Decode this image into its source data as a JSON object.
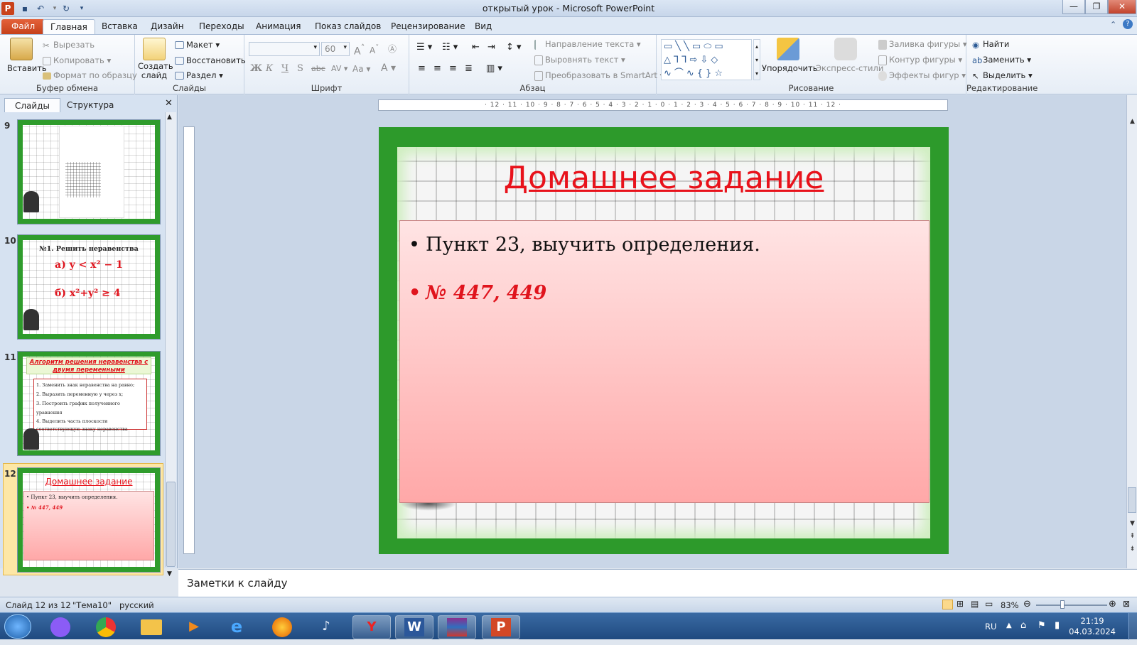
{
  "window": {
    "title": "открытый урок  -  Microsoft PowerPoint"
  },
  "ribbon_tabs": [
    "Файл",
    "Главная",
    "Вставка",
    "Дизайн",
    "Переходы",
    "Анимация",
    "Показ слайдов",
    "Рецензирование",
    "Вид"
  ],
  "clipboard": {
    "paste": "Вставить",
    "cut": "Вырезать",
    "copy": "Копировать",
    "format_painter": "Формат по образцу",
    "label": "Буфер обмена"
  },
  "slides_group": {
    "new_slide": "Создать слайд",
    "layout": "Макет",
    "reset": "Восстановить",
    "section": "Раздел",
    "label": "Слайды"
  },
  "font_group": {
    "font_size": "60",
    "label": "Шрифт"
  },
  "paragraph_group": {
    "text_direction": "Направление текста",
    "align_text": "Выровнять текст",
    "smartart": "Преобразовать в SmartArt",
    "label": "Абзац"
  },
  "drawing_group": {
    "arrange": "Упорядочить",
    "quick_styles": "Экспресс-стили",
    "shape_fill": "Заливка фигуры",
    "shape_outline": "Контур фигуры",
    "shape_effects": "Эффекты фигур",
    "label": "Рисование"
  },
  "editing_group": {
    "find": "Найти",
    "replace": "Заменить",
    "select": "Выделить",
    "label": "Редактирование"
  },
  "left_pane": {
    "tab_slides": "Слайды",
    "tab_outline": "Структура"
  },
  "thumbnails": [
    {
      "num": "9"
    },
    {
      "num": "10",
      "title": "№1. Решить неравенства",
      "line1": "а) y < x² − 1",
      "line2": "б) x²+y² ≥ 4"
    },
    {
      "num": "11",
      "title": "Алгоритм решения неравенства с двумя переменными",
      "items": [
        "Заменить знак неравенства на равно;",
        "Выразить переменную у через х;",
        "Построить график полученного уравнения",
        "Выделить часть плоскости соответствующую знаку неравенства"
      ]
    },
    {
      "num": "12",
      "title": "Домашнее задание",
      "b1": "Пункт 23, выучить определения.",
      "b2": "№ 447, 449"
    }
  ],
  "ruler": {
    "h": "· 12 · 11 · 10 · 9 · 8 · 7 · 6 · 5 · 4 · 3 · 2 · 1 · 0 · 1 · 2 · 3 · 4 · 5 · 6 · 7 · 8 · 9 · 10 · 11 · 12 ·"
  },
  "slide": {
    "title": "Домашнее задание",
    "bullet1": "Пункт 23, выучить определения.",
    "bullet2": "№ 447, 449"
  },
  "notes": {
    "placeholder": "Заметки к слайду"
  },
  "status": {
    "slide_info": "Слайд 12 из 12",
    "theme": "\"Тема10\"",
    "language": "русский",
    "zoom": "83%"
  },
  "taskbar": {
    "lang": "RU",
    "time": "21:19",
    "date": "04.03.2024"
  }
}
